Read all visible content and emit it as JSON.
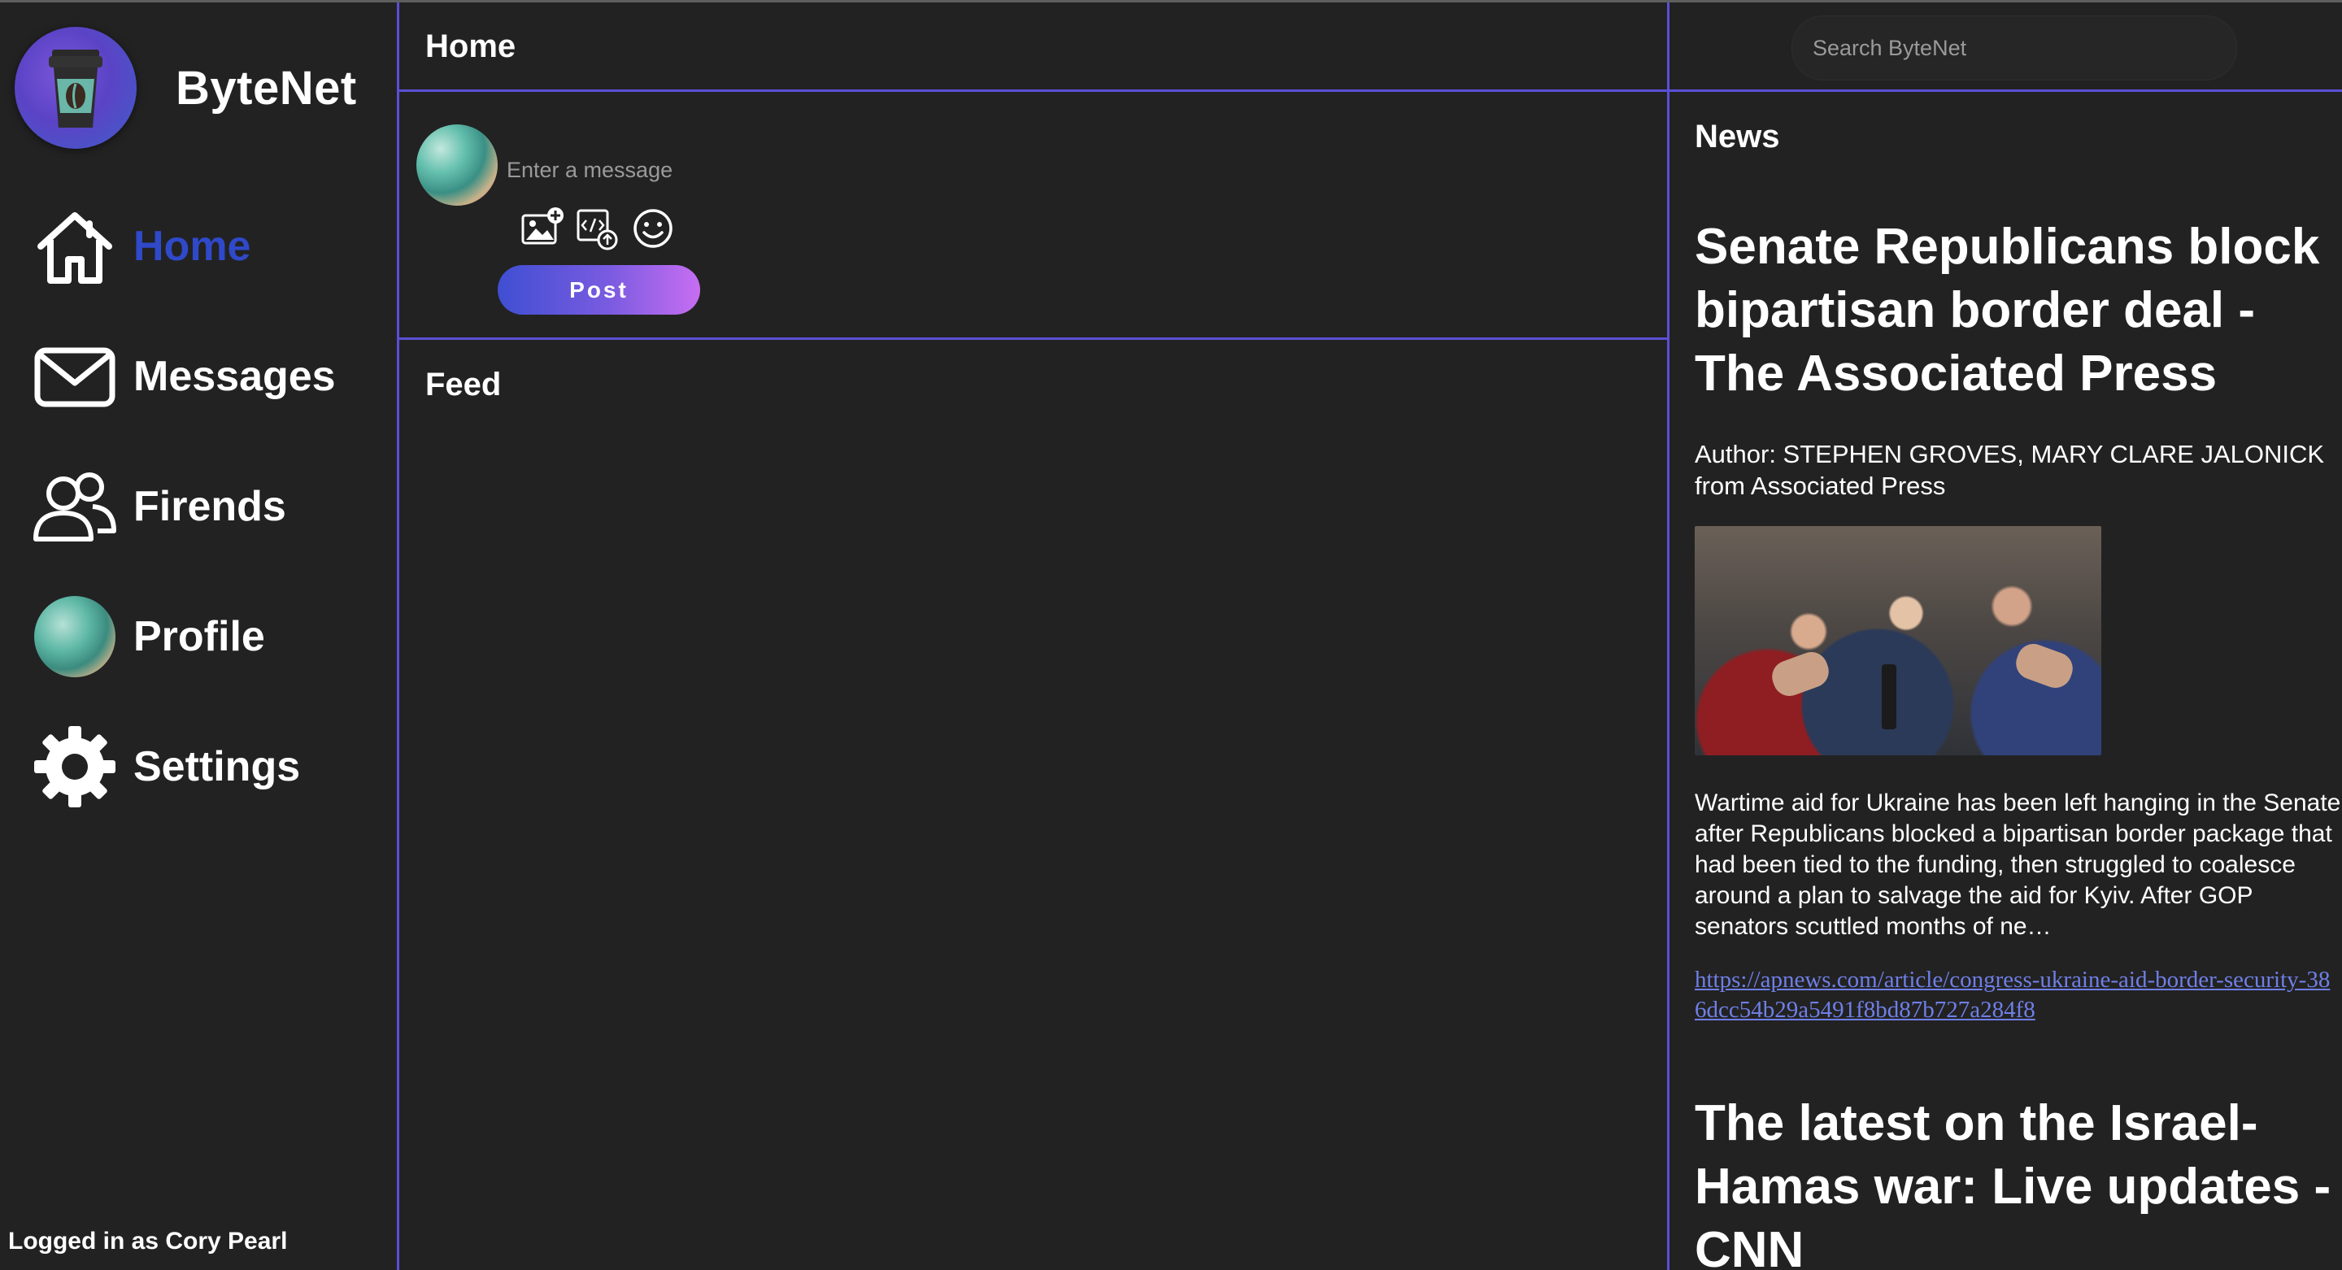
{
  "app": {
    "brand": "ByteNet",
    "logged_in_text": "Logged in as Cory Pearl",
    "accent_color": "#2f49c9",
    "divider_color": "#5b4fd6"
  },
  "sidebar": {
    "items": [
      {
        "label": "Home",
        "icon": "home-icon",
        "active": true
      },
      {
        "label": "Messages",
        "icon": "envelope-icon",
        "active": false
      },
      {
        "label": "Firends",
        "icon": "friends-icon",
        "active": false
      },
      {
        "label": "Profile",
        "icon": "profile-avatar",
        "active": false
      },
      {
        "label": "Settings",
        "icon": "gear-icon",
        "active": false
      }
    ]
  },
  "center": {
    "header": "Home",
    "composer": {
      "placeholder": "Enter a message",
      "post_label": "Post",
      "tools": [
        "image-add-icon",
        "code-upload-icon",
        "emoji-icon"
      ]
    },
    "feed_header": "Feed"
  },
  "right": {
    "search_placeholder": "Search ByteNet",
    "news_header": "News",
    "articles": [
      {
        "title": "Senate Republicans block bipartisan border deal - The Associated Press",
        "author": "Author: STEPHEN GROVES, MARY CLARE JALONICK from Associated Press",
        "body": "Wartime aid for Ukraine has been left hanging in the Senate after Republicans blocked a bipartisan border package that had been tied to the funding, then struggled to coalesce around a plan to salvage the aid for Kyiv. After GOP senators scuttled months of ne…",
        "link": "https://apnews.com/article/congress-ukraine-aid-border-security-386dcc54b29a5491f8bd87b727a284f8"
      },
      {
        "title": "The latest on the Israel-Hamas war: Live updates - CNN"
      }
    ]
  }
}
